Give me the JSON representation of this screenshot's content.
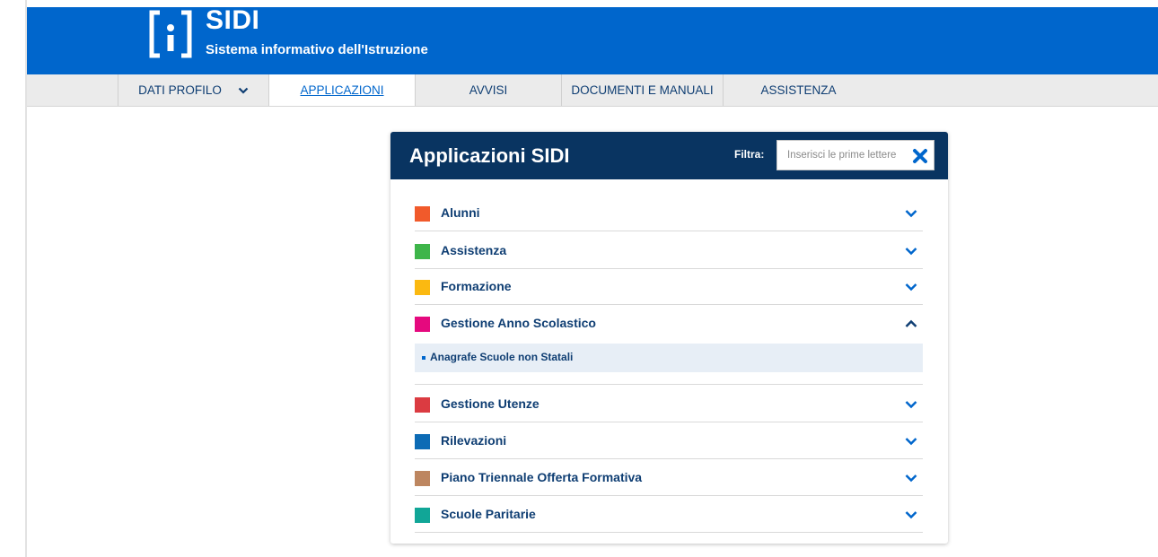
{
  "header": {
    "logo_title": "SIDI",
    "logo_subtitle": "Sistema informativo dell'Istruzione",
    "brand_color": "#0066cc"
  },
  "nav": {
    "items": [
      {
        "label": "DATI PROFILO",
        "has_dropdown": true,
        "active": false
      },
      {
        "label": "APPLICAZIONI",
        "active": true
      },
      {
        "label": "AVVISI",
        "active": false
      },
      {
        "label": "DOCUMENTI E MANUALI",
        "active": false
      },
      {
        "label": "ASSISTENZA",
        "active": false
      }
    ]
  },
  "panel": {
    "title": "Applicazioni SIDI",
    "header_color": "#093461",
    "filter": {
      "label": "Filtra:",
      "value": "",
      "placeholder": "Inserisci le prime lettere",
      "clear_icon": "close-x-icon"
    },
    "categories": [
      {
        "label": "Alunni",
        "color": "#f15a2b",
        "expanded": false
      },
      {
        "label": "Assistenza",
        "color": "#3eb54a",
        "expanded": false
      },
      {
        "label": "Formazione",
        "color": "#fbb911",
        "expanded": false
      },
      {
        "label": "Gestione Anno Scolastico",
        "color": "#e5097e",
        "expanded": true,
        "sub_items": [
          {
            "label": "Anagrafe Scuole non Statali"
          }
        ]
      },
      {
        "label": "Gestione Utenze",
        "color": "#db3b41",
        "expanded": false
      },
      {
        "label": "Rilevazioni",
        "color": "#0c6bb5",
        "expanded": false
      },
      {
        "label": "Piano Triennale Offerta Formativa",
        "color": "#bd8660",
        "expanded": false
      },
      {
        "label": "Scuole Paritarie",
        "color": "#11a697",
        "expanded": false
      }
    ]
  }
}
